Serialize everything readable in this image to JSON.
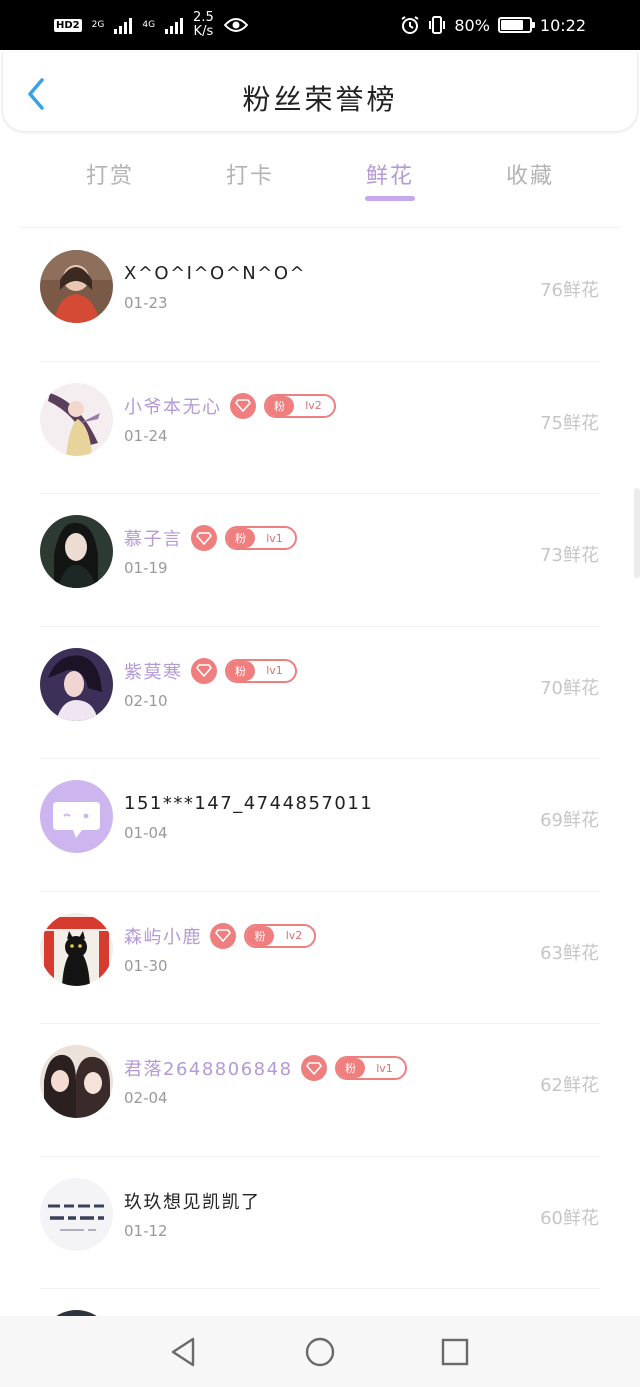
{
  "status_bar": {
    "hd_label": "HD",
    "hd_sub": "2",
    "net1": "2G",
    "net2": "4G",
    "speed_top": "2.5",
    "speed_bottom": "K/s",
    "battery_pct": "80%",
    "battery_level": 0.8,
    "time": "10:22"
  },
  "header": {
    "title": "粉丝荣誉榜",
    "back_icon": "chevron-left-icon"
  },
  "tabs": [
    {
      "label": "打赏",
      "active": false
    },
    {
      "label": "打卡",
      "active": false
    },
    {
      "label": "鲜花",
      "active": true
    },
    {
      "label": "收藏",
      "active": false
    }
  ],
  "rows": [
    {
      "name": "X^O^I^O^N^O^",
      "date": "01-23",
      "count": "76鲜花",
      "fan": false,
      "level": ""
    },
    {
      "name": "小爷本无心",
      "date": "01-24",
      "count": "75鲜花",
      "fan": true,
      "badge_label": "粉",
      "level": "lv2"
    },
    {
      "name": "慕子言",
      "date": "01-19",
      "count": "73鲜花",
      "fan": true,
      "badge_label": "粉",
      "level": "lv1"
    },
    {
      "name": "紫莫寒",
      "date": "02-10",
      "count": "70鲜花",
      "fan": true,
      "badge_label": "粉",
      "level": "lv1"
    },
    {
      "name": "151***147_4744857011",
      "date": "01-04",
      "count": "69鲜花",
      "fan": false,
      "level": ""
    },
    {
      "name": "森屿小鹿",
      "date": "01-30",
      "count": "63鲜花",
      "fan": true,
      "badge_label": "粉",
      "level": "lv2"
    },
    {
      "name": "君落2648806848",
      "date": "02-04",
      "count": "62鲜花",
      "fan": true,
      "badge_label": "粉",
      "level": "lv1"
    },
    {
      "name": "玖玖想见凯凯了",
      "date": "01-12",
      "count": "60鲜花",
      "fan": false,
      "level": ""
    }
  ],
  "colors": {
    "accent": "#b49ad6",
    "underline": "#c6a9ec",
    "badge": "#ef7e7e",
    "back_icon": "#3aa0e8"
  },
  "nav": {
    "back_icon": "triangle-back-icon",
    "home_icon": "circle-home-icon",
    "recents_icon": "square-recents-icon"
  }
}
